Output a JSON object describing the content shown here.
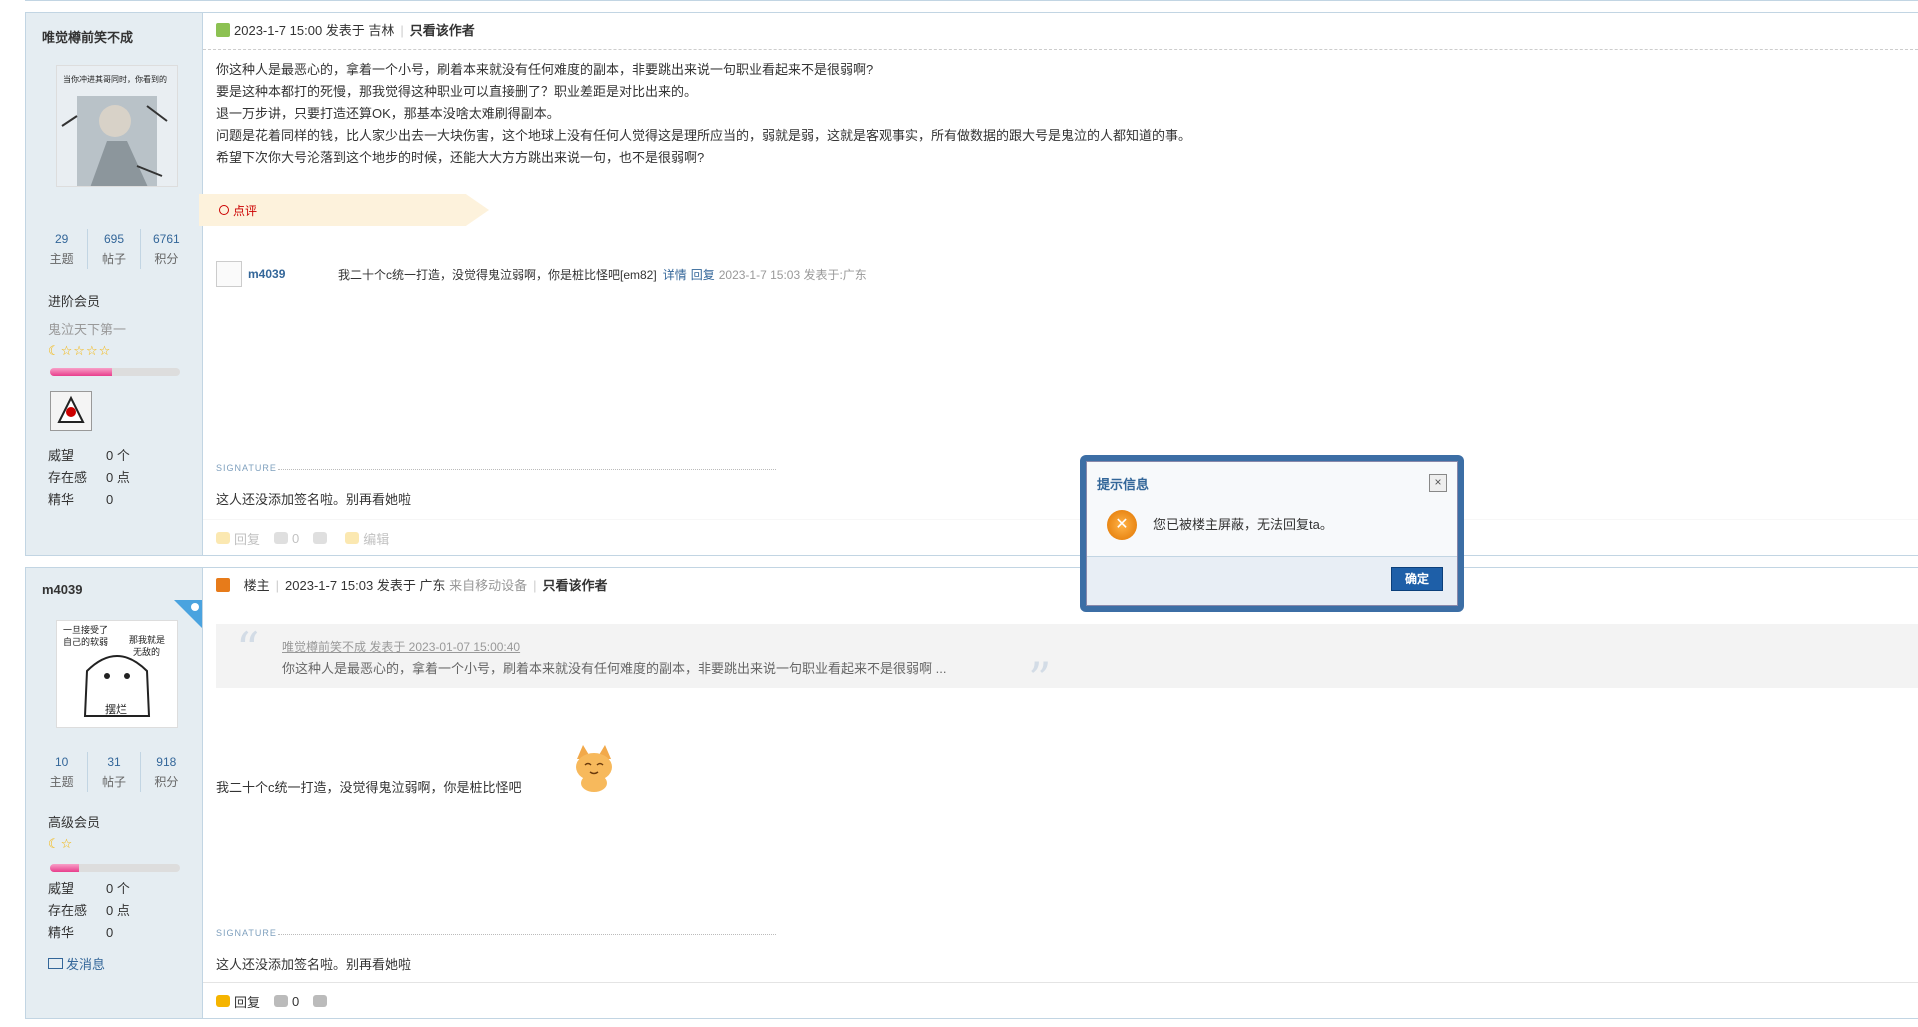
{
  "posts": [
    {
      "author": "唯觉樽前笑不成",
      "stats": [
        {
          "num": "29",
          "label": "主题"
        },
        {
          "num": "695",
          "label": "帖子"
        },
        {
          "num": "6761",
          "label": "积分"
        }
      ],
      "level": "进阶会员",
      "custom_title": "鬼泣天下第一",
      "stars": "☾☆☆☆☆",
      "progress": 0.48,
      "info": [
        {
          "k": "威望",
          "v": "0 个"
        },
        {
          "k": "存在感",
          "v": "0 点"
        },
        {
          "k": "精华",
          "v": "0"
        }
      ],
      "header": {
        "datetime": "2023-1-7 15:00 发表于 吉林",
        "only_author": "只看该作者"
      },
      "content": [
        "你这种人是最恶心的，拿着一个小号，刷着本来就没有任何难度的副本，非要跳出来说一句职业看起来不是很弱啊?",
        "要是这种本都打的死慢，那我觉得这种职业可以直接删了？职业差距是对比出来的。",
        "退一万步讲，只要打造还算OK，那基本没啥太难刷得副本。",
        "问题是花着同样的钱，比人家少出去一大块伤害，这个地球上没有任何人觉得这是理所应当的，弱就是弱，这就是客观事实，所有做数据的跟大号是鬼泣的人都知道的事。",
        "希望下次你大号沦落到这个地步的时候，还能大大方方跳出来说一句，也不是很弱啊?"
      ],
      "rate_label": "点评",
      "comment": {
        "user": "m4039",
        "text": "我二十个c统一打造，没觉得鬼泣弱啊，你是桩比怪吧[em82]",
        "detail": "详情",
        "reply": "回复",
        "meta": "2023-1-7 15:03 发表于:广东"
      },
      "signature_label": "SIGNATURE",
      "signature": "这人还没添加签名啦。别再看她啦",
      "actions": {
        "reply": "回复",
        "like": "0",
        "edit": "编辑"
      }
    },
    {
      "author": "m4039",
      "stats": [
        {
          "num": "10",
          "label": "主题"
        },
        {
          "num": "31",
          "label": "帖子"
        },
        {
          "num": "918",
          "label": "积分"
        }
      ],
      "level": "高级会员",
      "stars": "☾☆",
      "progress": 0.22,
      "info": [
        {
          "k": "威望",
          "v": "0 个"
        },
        {
          "k": "存在感",
          "v": "0 点"
        },
        {
          "k": "精华",
          "v": "0"
        }
      ],
      "send_message": "发消息",
      "header": {
        "role": "楼主",
        "datetime": "2023-1-7 15:03 发表于 广东",
        "device": "来自移动设备",
        "only_author": "只看该作者"
      },
      "quote": {
        "head": "唯觉樽前笑不成 发表于 2023-01-07 15:00:40",
        "text": "你这种人是最恶心的，拿着一个小号，刷着本来就没有任何难度的副本，非要跳出来说一句职业看起来不是很弱啊 ..."
      },
      "reply_text": "我二十个c统一打造，没觉得鬼泣弱啊，你是桩比怪吧",
      "signature_label": "SIGNATURE",
      "signature": "这人还没添加签名啦。别再看她啦",
      "actions": {
        "reply": "回复",
        "like": "0"
      }
    }
  ],
  "dialog": {
    "title": "提示信息",
    "close": "×",
    "message": "您已被楼主屏蔽，无法回复ta。",
    "ok": "确定"
  }
}
